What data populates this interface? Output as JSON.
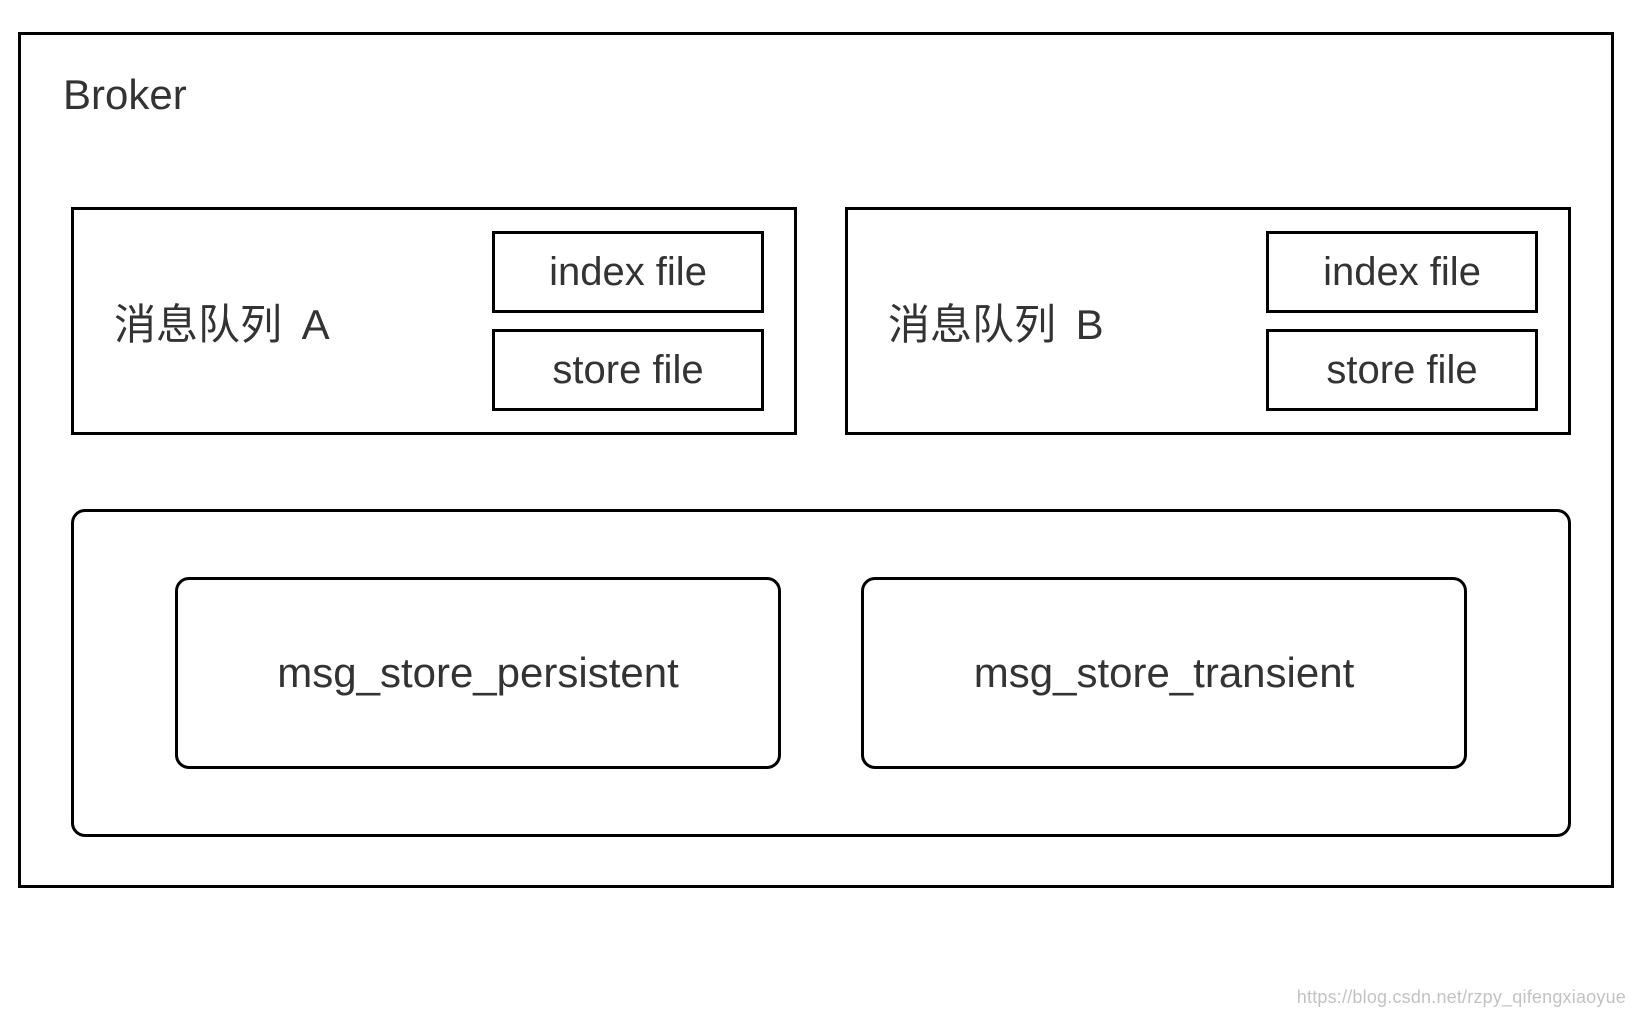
{
  "broker": {
    "title": "Broker",
    "queues": [
      {
        "label": "消息队列 A",
        "files": {
          "index": "index file",
          "store": "store file"
        }
      },
      {
        "label": "消息队列  B",
        "files": {
          "index": "index file",
          "store": "store file"
        }
      }
    ],
    "storage": {
      "persistent": "msg_store_persistent",
      "transient": "msg_store_transient"
    }
  },
  "watermark": "https://blog.csdn.net/rzpy_qifengxiaoyue"
}
